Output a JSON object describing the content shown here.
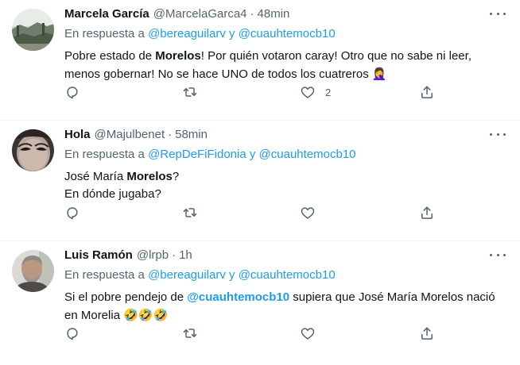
{
  "tweets": [
    {
      "name": "Marcela García",
      "handle": "@MarcelaGarca4",
      "separator": "·",
      "time": "48min",
      "reply_prefix": "En respuesta a",
      "reply_user1": "@bereaguilarv",
      "reply_join": "y",
      "reply_user2": "@cuauhtemocb10",
      "body_parts": [
        {
          "text": "Pobre estado de ",
          "bold": false
        },
        {
          "text": "Morelos",
          "bold": true
        },
        {
          "text": "!  Por quién votaron caray!  Otro que no sabe ni leer, menos gobernar!  No se hace UNO de todos los cuatreros ",
          "bold": false
        },
        {
          "text": "🤦‍♀️",
          "bold": false,
          "emoji": true
        }
      ],
      "like_count": "2",
      "avatar_icon": "landscape-photo"
    },
    {
      "name": "Hola",
      "handle": "@Majulbenet",
      "separator": "·",
      "time": "58min",
      "reply_prefix": "En respuesta a",
      "reply_user1": "@RepDeFiFidonia",
      "reply_join": "y",
      "reply_user2": "@cuauhtemocb10",
      "body_parts": [
        {
          "text": "José María ",
          "bold": false
        },
        {
          "text": "Morelos",
          "bold": true
        },
        {
          "text": "?",
          "bold": false
        },
        {
          "br": true
        },
        {
          "text": "En dónde jugaba?",
          "bold": false
        }
      ],
      "like_count": "",
      "avatar_icon": "face-photo"
    },
    {
      "name": "Luis Ramón",
      "handle": "@lrpb",
      "separator": "·",
      "time": "1h",
      "reply_prefix": "En respuesta a",
      "reply_user1": "@bereaguilarv",
      "reply_join": "y",
      "reply_user2": "@cuauhtemocb10",
      "body_parts": [
        {
          "text": "Si el pobre pendejo de ",
          "bold": false
        },
        {
          "text": "@cuauhtemocb10",
          "bold": true,
          "link": true
        },
        {
          "text": " supiera que José María Morelos nació en Morelia ",
          "bold": false
        },
        {
          "text": "🤣🤣🤣",
          "bold": false,
          "emoji": true
        }
      ],
      "like_count": "",
      "avatar_icon": "man-photo"
    }
  ],
  "colors": {
    "link": "#1d9bf0",
    "secondary": "#536471",
    "primary_text": "#0f1419",
    "divider": "#eff3f4"
  },
  "action_icons": [
    "reply-icon",
    "retweet-icon",
    "like-icon",
    "share-icon"
  ]
}
